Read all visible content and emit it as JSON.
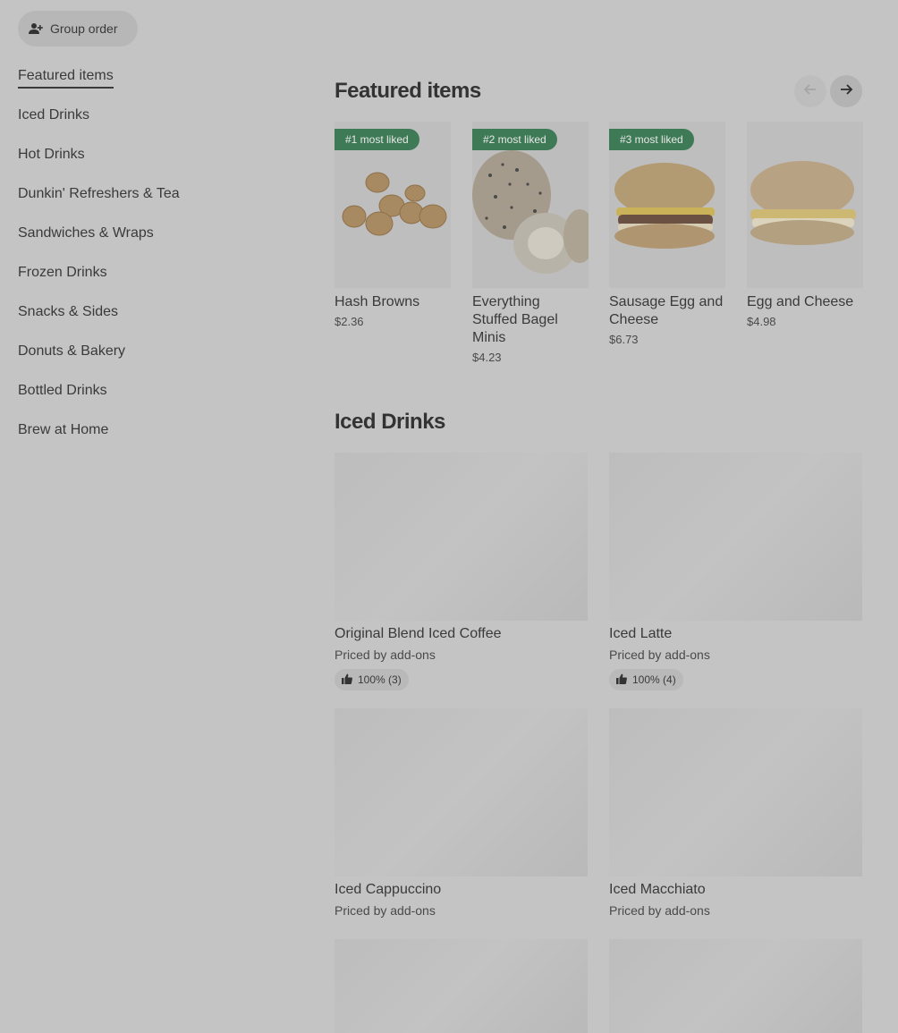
{
  "group_order": {
    "label": "Group order",
    "icon": "add-person-icon"
  },
  "sidebar": {
    "items": [
      {
        "label": "Featured items",
        "active": true
      },
      {
        "label": "Iced Drinks"
      },
      {
        "label": "Hot Drinks"
      },
      {
        "label": "Dunkin' Refreshers & Tea"
      },
      {
        "label": "Sandwiches & Wraps"
      },
      {
        "label": "Frozen Drinks"
      },
      {
        "label": "Snacks & Sides"
      },
      {
        "label": "Donuts & Bakery"
      },
      {
        "label": "Bottled Drinks"
      },
      {
        "label": "Brew at Home"
      }
    ]
  },
  "featured": {
    "title": "Featured items",
    "items": [
      {
        "badge": "#1 most liked",
        "name": "Hash Browns",
        "price": "$2.36"
      },
      {
        "badge": "#2 most liked",
        "name": "Everything Stuffed Bagel Minis",
        "price": "$4.23"
      },
      {
        "badge": "#3 most liked",
        "name": "Sausage Egg and Cheese",
        "price": "$6.73"
      },
      {
        "badge": "",
        "name": "Egg and Cheese",
        "price": "$4.98"
      }
    ]
  },
  "iced": {
    "title": "Iced Drinks",
    "items": [
      {
        "name": "Original Blend Iced Coffee",
        "sub": "Priced by add-ons",
        "rating": "100% (3)"
      },
      {
        "name": "Iced Latte",
        "sub": "Priced by add-ons",
        "rating": "100% (4)"
      },
      {
        "name": "Iced Cappuccino",
        "sub": "Priced by add-ons",
        "rating": ""
      },
      {
        "name": "Iced Macchiato",
        "sub": "Priced by add-ons",
        "rating": ""
      }
    ]
  },
  "colors": {
    "badge": "#3d7a55",
    "overlay": "#c4c4c4"
  }
}
